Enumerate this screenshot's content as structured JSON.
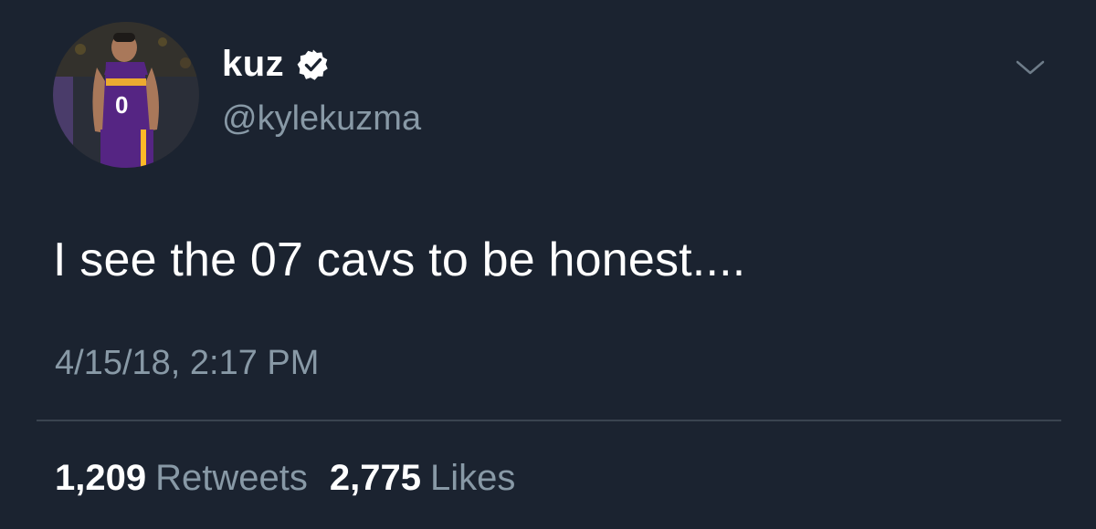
{
  "tweet": {
    "author": {
      "display_name": "kuz",
      "handle": "@kylekuzma",
      "verified": true,
      "avatar_icon": "profile-photo"
    },
    "text": "I see the 07 cavs to be honest....",
    "timestamp": "4/15/18, 2:17 PM",
    "stats": {
      "retweets_count": "1,209",
      "retweets_label": "Retweets",
      "likes_count": "2,775",
      "likes_label": "Likes"
    }
  },
  "colors": {
    "background": "#1b2330",
    "primary_text": "#ffffff",
    "secondary_text": "#8899a6",
    "divider": "#3a4450",
    "jersey_purple": "#552583",
    "jersey_gold": "#fdb927"
  },
  "icons": {
    "verified": "verified-badge-icon",
    "menu": "chevron-down-icon"
  }
}
